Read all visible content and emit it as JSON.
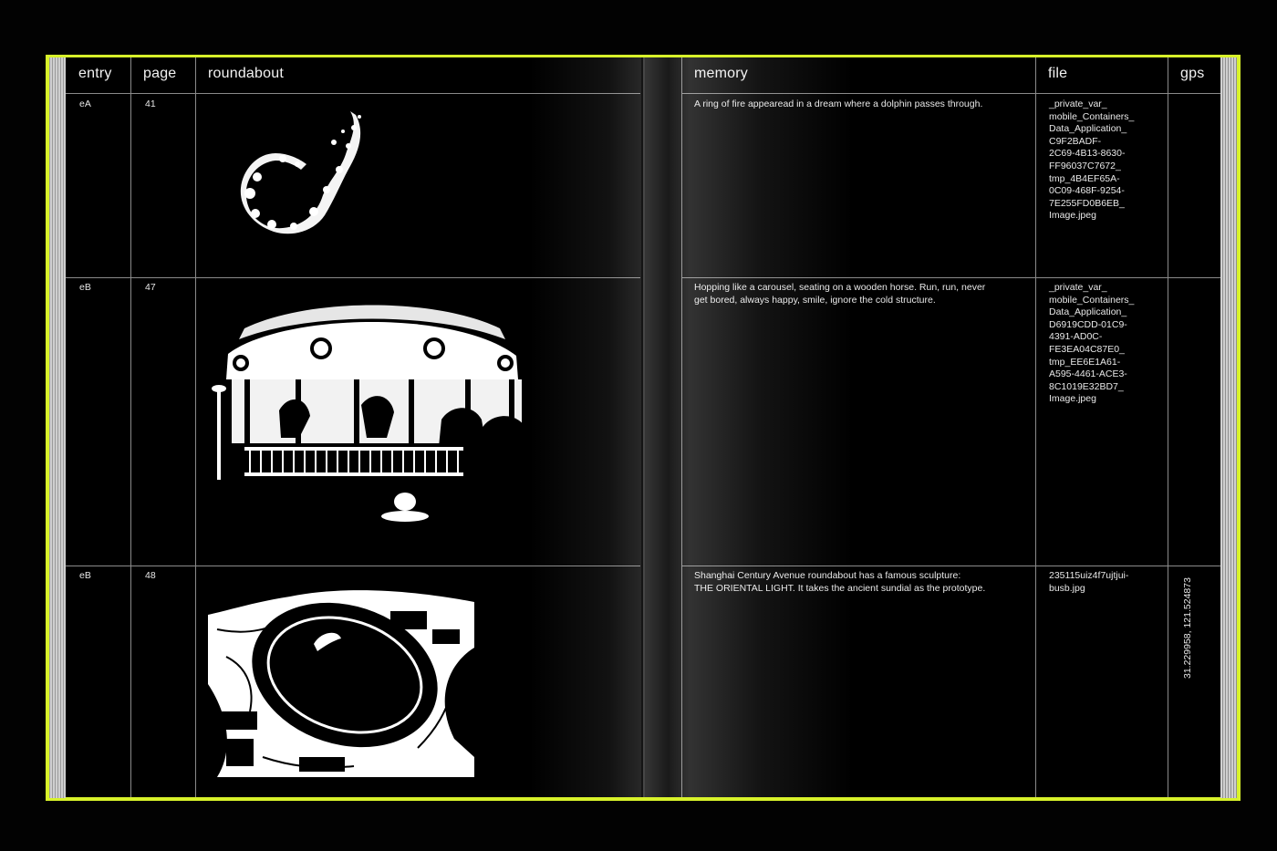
{
  "columns": {
    "entry": "entry",
    "page": "page",
    "roundabout": "roundabout",
    "memory": "memory",
    "file": "file",
    "gps": "gps"
  },
  "rows": [
    {
      "entry": "eA",
      "page": "41",
      "image": "ring-of-fire-image",
      "memory": [
        "A ring of fire appearead in a dream where a dolphin passes through."
      ],
      "file": [
        "_private_var_",
        "mobile_Containers_",
        "Data_Application_",
        "C9F2BADF-",
        "2C69-4B13-8630-",
        "FF96037C7672_",
        "tmp_4B4EF65A-",
        "0C09-468F-9254-",
        "7E255FD0B6EB_",
        "Image.jpeg"
      ],
      "gps": ""
    },
    {
      "entry": "eB",
      "page": "47",
      "image": "carousel-image",
      "memory": [
        "Hopping like a carousel, seating on a wooden horse. Run, run, never",
        "get bored, always happy, smile, ignore the cold structure."
      ],
      "file": [
        "_private_var_",
        "mobile_Containers_",
        "Data_Application_",
        "D6919CDD-01C9-",
        "4391-AD0C-",
        "FE3EA04C87E0_",
        "tmp_EE6E1A61-",
        "A595-4461-ACE3-",
        "8C1019E32BD7_",
        "Image.jpeg"
      ],
      "gps": ""
    },
    {
      "entry": "eB",
      "page": "48",
      "image": "aerial-roundabout-image",
      "memory": [
        "Shanghai Century Avenue roundabout has a famous sculpture:",
        "THE ORIENTAL LIGHT. It takes the ancient sundial as the prototype."
      ],
      "file": [
        "235115uiz4f7ujtjui-",
        "busb.jpg"
      ],
      "gps": "31.229958, 121.524873"
    }
  ],
  "colors": {
    "cover": "#d8f22a",
    "page": "#000000",
    "rule": "#8a8a8a",
    "text": "#e8e8e8"
  }
}
